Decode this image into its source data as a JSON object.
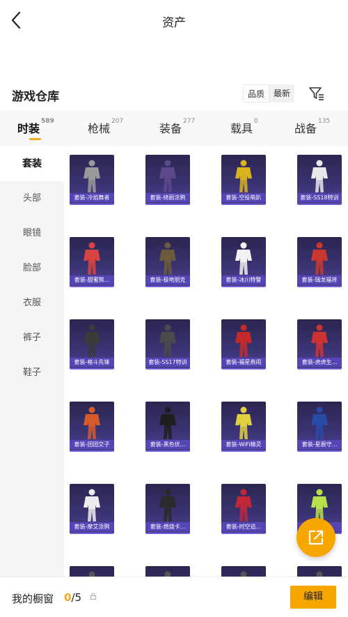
{
  "header": {
    "title": "资产",
    "back_icon": "back-arrow-icon"
  },
  "section": {
    "title": "游戏仓库",
    "sort_options": [
      "品质",
      "最新"
    ],
    "filter_icon": "filter-icon"
  },
  "tabs": [
    {
      "label": "时装",
      "count": "589",
      "active": true
    },
    {
      "label": "枪械",
      "count": "207"
    },
    {
      "label": "装备",
      "count": "277"
    },
    {
      "label": "载具",
      "count": "0"
    },
    {
      "label": "战备",
      "count": "135"
    }
  ],
  "sidebar": [
    {
      "label": "套装",
      "active": true
    },
    {
      "label": "头部"
    },
    {
      "label": "眼镜"
    },
    {
      "label": "脸部"
    },
    {
      "label": "衣服"
    },
    {
      "label": "裤子"
    },
    {
      "label": "鞋子"
    }
  ],
  "items": [
    {
      "label": "套装-冷焰舞者",
      "tone": "#9a9a9a"
    },
    {
      "label": "套装-绮丽涂鸦",
      "tone": "#5a4a8a"
    },
    {
      "label": "套装-空投萌趴",
      "tone": "#d9b21d"
    },
    {
      "label": "套装-SS18特训",
      "tone": "#e8e8e8"
    },
    {
      "label": "套装-甜蜜熊...",
      "tone": "#d9433f"
    },
    {
      "label": "套装-极地朋克",
      "tone": "#6b5b3a"
    },
    {
      "label": "套装-冰川特警",
      "tone": "#f2f2f2"
    },
    {
      "label": "套装-瑞龙福将",
      "tone": "#c8382e"
    },
    {
      "label": "套装-格斗先锋",
      "tone": "#3a3a3a"
    },
    {
      "label": "套装-SS17特训",
      "tone": "#4a4a4a"
    },
    {
      "label": "套装-福星燕闹",
      "tone": "#c42a2a"
    },
    {
      "label": "套装-虎虎生...",
      "tone": "#cc3333"
    },
    {
      "label": "套装-团团交子",
      "tone": "#d65a2a"
    },
    {
      "label": "套装-黑色伏...",
      "tone": "#1e1e1e"
    },
    {
      "label": "套装-WiFi精灵",
      "tone": "#e0d040"
    },
    {
      "label": "套装-星辰守...",
      "tone": "#2a4aa8"
    },
    {
      "label": "套装-摩艾涂鸦",
      "tone": "#ededed"
    },
    {
      "label": "套装-燃烧卡...",
      "tone": "#2a2a2a"
    },
    {
      "label": "套装-时空追...",
      "tone": "#c0283a"
    },
    {
      "label": "套装-...",
      "tone": "#b8e04a"
    },
    {
      "label": "",
      "tone": "#555"
    },
    {
      "label": "",
      "tone": "#555"
    },
    {
      "label": "",
      "tone": "#555"
    },
    {
      "label": "",
      "tone": "#555"
    }
  ],
  "fab_icon": "share-out-icon",
  "footer": {
    "label": "我的橱窗",
    "current": "0",
    "total": "/5",
    "lock_icon": "lock-icon",
    "edit_label": "编辑"
  },
  "colors": {
    "accent": "#f7a600",
    "card_bg": "#3a3372"
  }
}
